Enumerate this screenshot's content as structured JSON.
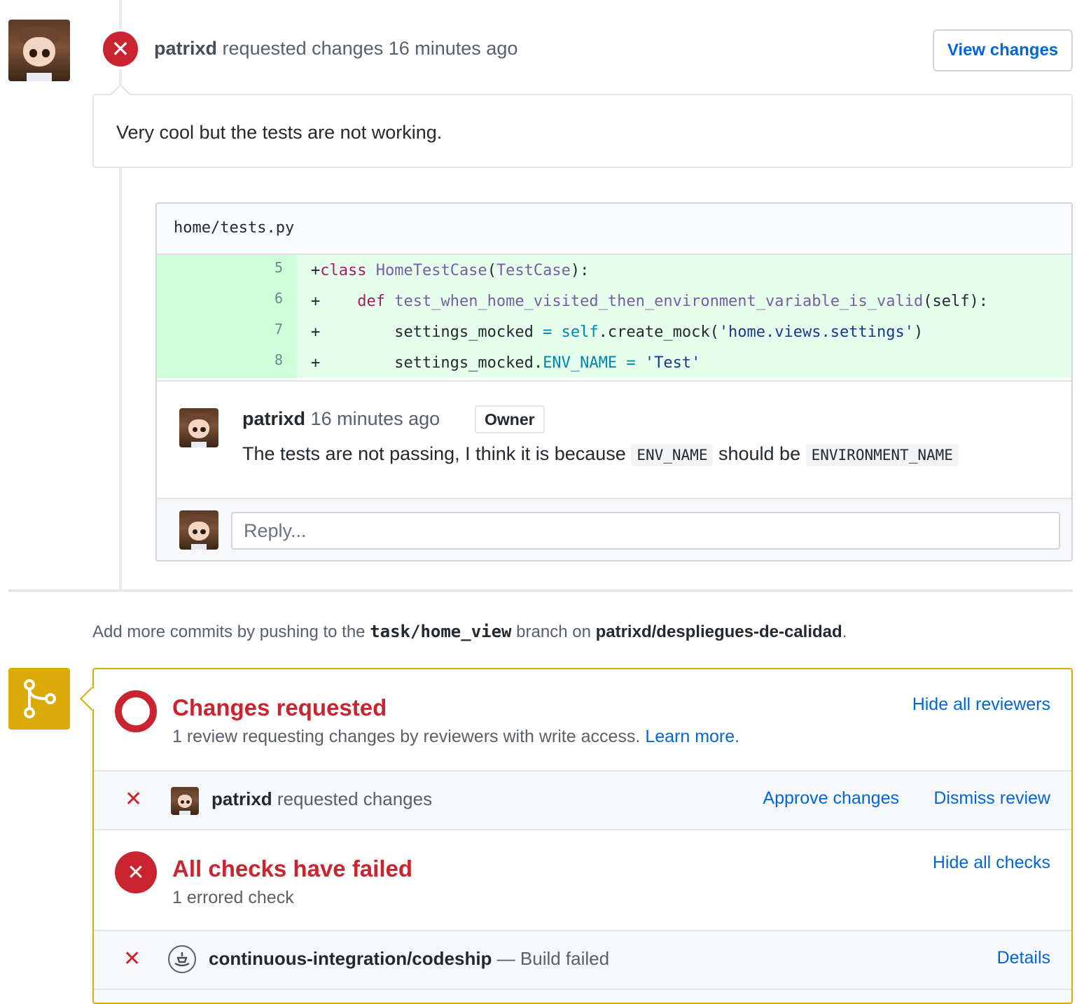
{
  "review": {
    "author": "patrixd",
    "action": "requested changes",
    "time": "16 minutes ago",
    "view_changes_label": "View changes",
    "status_icon": "x-icon",
    "body": "Very cool but the tests are not working."
  },
  "file": {
    "path": "home/tests.py",
    "lines": [
      {
        "num": "5",
        "prefix": "+",
        "tokens": [
          [
            "kw",
            "class"
          ],
          [
            "",
            " "
          ],
          [
            "fn",
            "HomeTestCase"
          ],
          [
            "",
            "("
          ],
          [
            "fn",
            "TestCase"
          ],
          [
            "",
            "):"
          ]
        ]
      },
      {
        "num": "6",
        "prefix": "+",
        "tokens": [
          [
            "",
            "    "
          ],
          [
            "kw",
            "def"
          ],
          [
            "",
            " "
          ],
          [
            "fn",
            "test_when_home_visited_then_environment_variable_is_valid"
          ],
          [
            "",
            "(self):"
          ]
        ]
      },
      {
        "num": "7",
        "prefix": "+",
        "tokens": [
          [
            "",
            "        settings_mocked "
          ],
          [
            "sf",
            "="
          ],
          [
            "",
            " "
          ],
          [
            "sf",
            "self"
          ],
          [
            "",
            ".create_mock("
          ],
          [
            "str",
            "'home.views.settings'"
          ],
          [
            "",
            ")"
          ]
        ]
      },
      {
        "num": "8",
        "prefix": "+",
        "tokens": [
          [
            "",
            "        settings_mocked."
          ],
          [
            "sf",
            "ENV_NAME"
          ],
          [
            "",
            " "
          ],
          [
            "sf",
            "="
          ],
          [
            "",
            " "
          ],
          [
            "str",
            "'Test'"
          ]
        ]
      }
    ]
  },
  "inline_comment": {
    "author": "patrixd",
    "time": "16 minutes ago",
    "badge": "Owner",
    "text_before": "The tests are not passing, I think it is because",
    "code1": "ENV_NAME",
    "text_middle": "should be",
    "code2": "ENVIRONMENT_NAME"
  },
  "reply": {
    "placeholder": "Reply..."
  },
  "push_note": {
    "prefix": "Add more commits by pushing to the",
    "branch": "task/home_view",
    "middle": "branch on",
    "repo": "patrixd/despliegues-de-calidad",
    "suffix": "."
  },
  "merge": {
    "changes_title": "Changes requested",
    "changes_sub": "1 review requesting changes by reviewers with write access.",
    "learn_more": "Learn more.",
    "hide_reviewers": "Hide all reviewers",
    "reviewer_name": "patrixd",
    "reviewer_action": "requested changes",
    "approve_label": "Approve changes",
    "dismiss_label": "Dismiss review",
    "checks_title": "All checks have failed",
    "checks_sub": "1 errored check",
    "hide_checks": "Hide all checks",
    "check_name": "continuous-integration/codeship",
    "check_status": "— Build failed",
    "details_label": "Details"
  },
  "colors": {
    "danger": "#cb2431",
    "link": "#0366d6",
    "warning": "#dbab09",
    "added_bg": "#e6ffed"
  }
}
